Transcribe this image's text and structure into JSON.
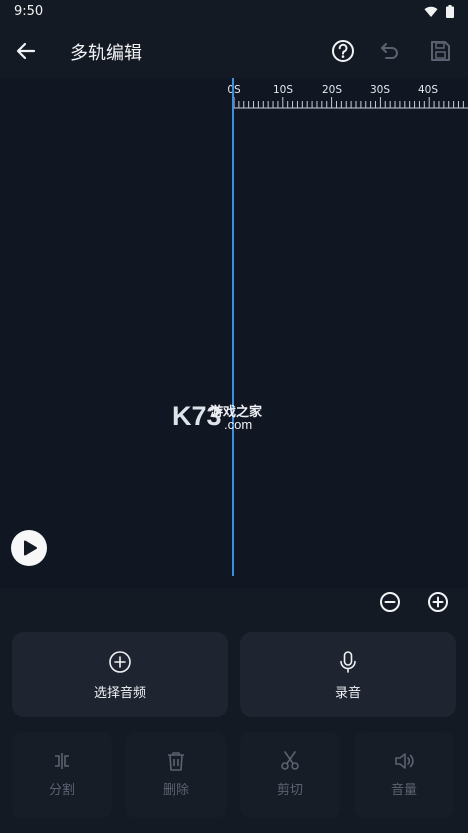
{
  "status_bar": {
    "time": "9:50"
  },
  "header": {
    "title": "多轨编辑"
  },
  "timeline": {
    "ruler_labels": [
      "0S",
      "10S",
      "20S",
      "30S",
      "40S"
    ]
  },
  "watermark": {
    "brand": "K73",
    "text": "游戏之家",
    "domain": ".com"
  },
  "actions": {
    "select_audio": "选择音频",
    "record": "录音"
  },
  "tools": {
    "split": "分割",
    "delete": "删除",
    "cut": "剪切",
    "volume": "音量"
  },
  "colors": {
    "background": "#141a24",
    "playhead": "#3d8fe0",
    "card": "#1e2531"
  }
}
